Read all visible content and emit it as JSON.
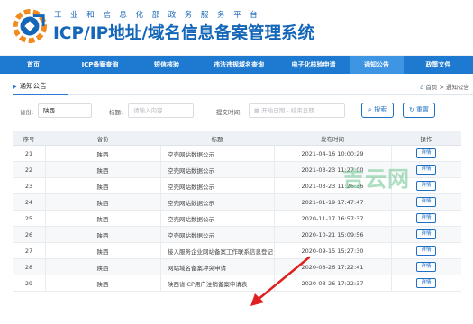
{
  "header": {
    "ministry": "工业和信息化部政务服务平台",
    "title": "ICP/IP地址/域名信息备案管理系统"
  },
  "nav": {
    "items": [
      {
        "label": "首页"
      },
      {
        "label": "ICP备案查询"
      },
      {
        "label": "短信核验"
      },
      {
        "label": "违法违规域名查询"
      },
      {
        "label": "电子化核验申请"
      },
      {
        "label": "通知公告"
      },
      {
        "label": "政策文件"
      }
    ]
  },
  "breadcrumb": {
    "title": "通知公告",
    "home": "首页",
    "sep": ">",
    "current": "通知公告"
  },
  "filter": {
    "province_label": "省份:",
    "province_value": "陕西",
    "title_label": "标题:",
    "title_placeholder": "请输入内容",
    "time_label": "提交时间:",
    "start_placeholder": "开始日期",
    "range_sep": "-",
    "end_placeholder": "结束日期",
    "search_button": "搜索",
    "reset_button": "重置"
  },
  "table": {
    "headers": [
      "序号",
      "省份",
      "标题",
      "发布时间",
      "操作"
    ],
    "rows": [
      {
        "no": "21",
        "province": "陕西",
        "title": "空壳网站数据公示",
        "time": "2021-04-16 10:00:29",
        "action": "详情"
      },
      {
        "no": "22",
        "province": "陕西",
        "title": "空壳网站数据公示",
        "time": "2021-03-23 11:27:00",
        "action": "详情"
      },
      {
        "no": "23",
        "province": "陕西",
        "title": "空壳网站数据公示",
        "time": "2021-03-23 11:26:36",
        "action": "详情"
      },
      {
        "no": "24",
        "province": "陕西",
        "title": "空壳网站数据公示",
        "time": "2021-01-19 17:47:47",
        "action": "详情"
      },
      {
        "no": "25",
        "province": "陕西",
        "title": "空壳网站数据公示",
        "time": "2020-11-17 16:57:37",
        "action": "详情"
      },
      {
        "no": "26",
        "province": "陕西",
        "title": "空壳网站数据公示",
        "time": "2020-10-21 15:09:56",
        "action": "详情"
      },
      {
        "no": "27",
        "province": "陕西",
        "title": "接入服务企业网站备案工作联系信息登记",
        "time": "2020-09-15 15:27:30",
        "action": "详情"
      },
      {
        "no": "28",
        "province": "陕西",
        "title": "网站域名备案冲突申请",
        "time": "2020-08-26 17:22:41",
        "action": "详情"
      },
      {
        "no": "29",
        "province": "陕西",
        "title": "陕西省ICP用户注销备案申请表",
        "time": "2020-08-26 17:22:37",
        "action": "详情"
      }
    ]
  },
  "watermark": "吉云网",
  "colors": {
    "brand_blue": "#1466b8",
    "nav_blue": "#1e7ad0",
    "nav_active": "#3d95e4",
    "arrow_red": "#e02020",
    "logo_orange": "#f28a1e"
  }
}
